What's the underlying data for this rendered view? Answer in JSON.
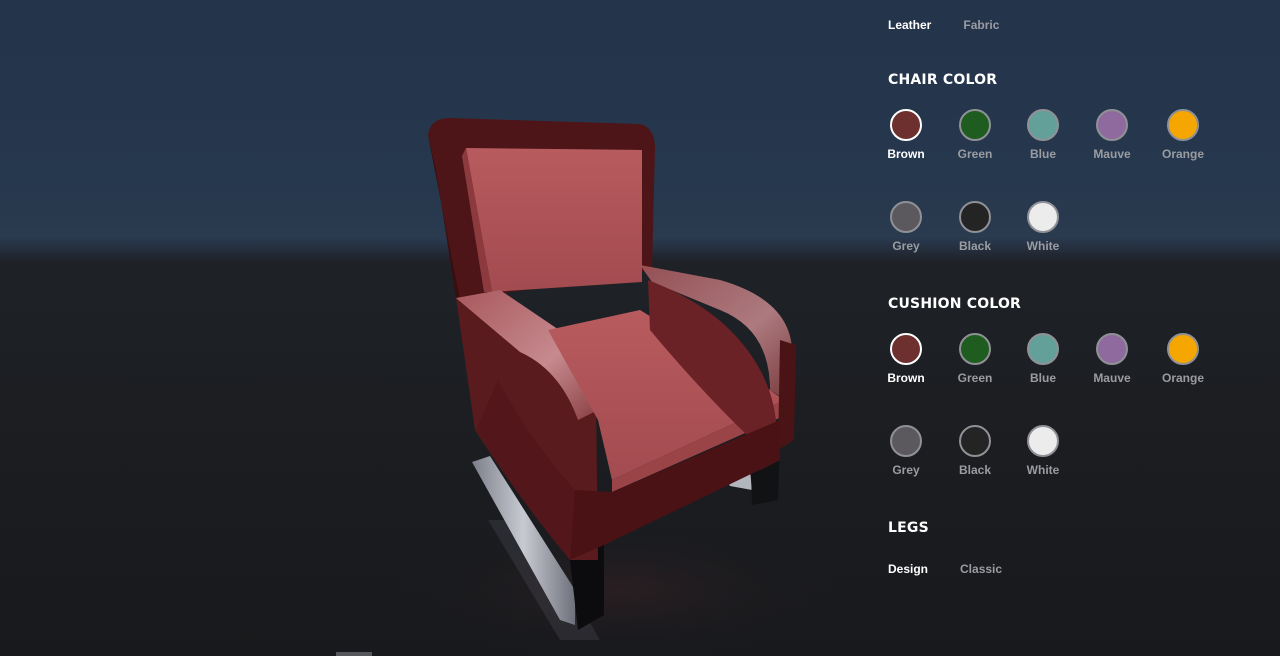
{
  "material_tabs": {
    "items": [
      "Leather",
      "Fabric"
    ],
    "active": "Leather"
  },
  "chair_color": {
    "heading": "CHAIR COLOR",
    "selected": "Brown",
    "swatches": [
      {
        "label": "Brown",
        "color": "#6e2f2f"
      },
      {
        "label": "Green",
        "color": "#1f5c1f"
      },
      {
        "label": "Blue",
        "color": "#64a09a"
      },
      {
        "label": "Mauve",
        "color": "#8f6a9e"
      },
      {
        "label": "Orange",
        "color": "#f6a600"
      },
      {
        "label": "Grey",
        "color": "#5b595e"
      },
      {
        "label": "Black",
        "color": "#242424"
      },
      {
        "label": "White",
        "color": "#ececec"
      }
    ]
  },
  "cushion_color": {
    "heading": "CUSHION COLOR",
    "selected": "Brown",
    "swatches": [
      {
        "label": "Brown",
        "color": "#6e2f2f"
      },
      {
        "label": "Green",
        "color": "#1f5c1f"
      },
      {
        "label": "Blue",
        "color": "#64a09a"
      },
      {
        "label": "Mauve",
        "color": "#8f6a9e"
      },
      {
        "label": "Orange",
        "color": "#f6a600"
      },
      {
        "label": "Grey",
        "color": "#5b595e"
      },
      {
        "label": "Black",
        "color": "#242424"
      },
      {
        "label": "White",
        "color": "#ececec"
      }
    ]
  },
  "legs": {
    "heading": "LEGS",
    "items": [
      "Design",
      "Classic"
    ],
    "active": "Design"
  }
}
